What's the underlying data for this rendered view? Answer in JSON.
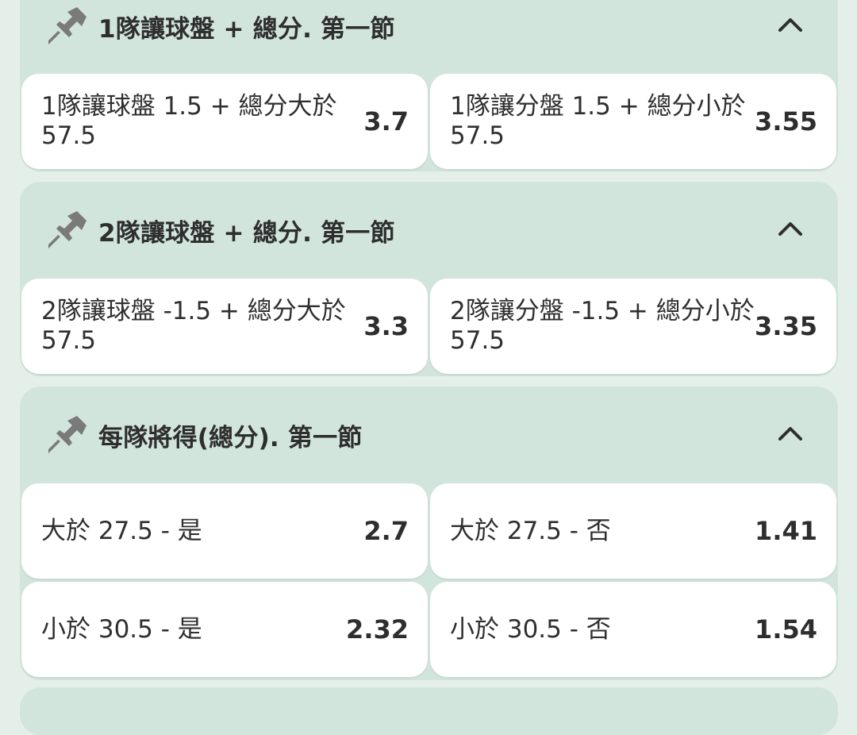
{
  "colors": {
    "page_background": "#e5efea",
    "market_background": "#d1e5dd",
    "outcome_background": "#ffffff",
    "text": "#2e2e2e",
    "icon": "#7a7a7a"
  },
  "markets": [
    {
      "title": "1隊讓球盤 + 總分. 第一節",
      "pin_icon": "pin-icon",
      "collapse_icon": "chevron-up-icon",
      "outcomes": [
        {
          "label": "1隊讓球盤 1.5 + 總分大於 57.5",
          "odds": "3.7"
        },
        {
          "label": "1隊讓分盤 1.5 + 總分小於 57.5",
          "odds": "3.55"
        }
      ]
    },
    {
      "title": "2隊讓球盤 + 總分. 第一節",
      "pin_icon": "pin-icon",
      "collapse_icon": "chevron-up-icon",
      "outcomes": [
        {
          "label": "2隊讓球盤 -1.5 + 總分大於 57.5",
          "odds": "3.3"
        },
        {
          "label": "2隊讓分盤 -1.5 + 總分小於 57.5",
          "odds": "3.35"
        }
      ]
    },
    {
      "title": "每隊將得(總分). 第一節",
      "pin_icon": "pin-icon",
      "collapse_icon": "chevron-up-icon",
      "outcomes": [
        {
          "label": "大於 27.5 - 是",
          "odds": "2.7"
        },
        {
          "label": "大於 27.5 - 否",
          "odds": "1.41"
        },
        {
          "label": "小於 30.5 - 是",
          "odds": "2.32"
        },
        {
          "label": "小於 30.5 - 否",
          "odds": "1.54"
        }
      ]
    }
  ]
}
